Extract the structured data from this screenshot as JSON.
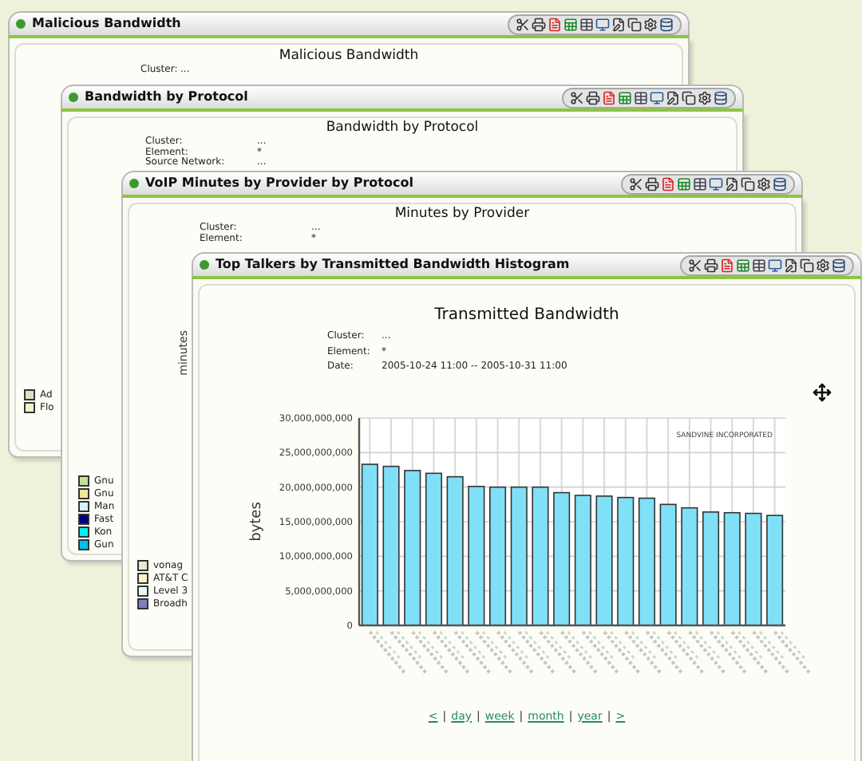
{
  "windows": [
    {
      "title": "Malicious Bandwidth",
      "report_title": "Malicious Bandwidth",
      "filters": [
        {
          "label": "Cluster:",
          "value": "..."
        }
      ],
      "legend": [
        {
          "label": "Ad",
          "color": "#d6e6c2"
        },
        {
          "label": "Flo",
          "color": "#f6f2c8"
        }
      ]
    },
    {
      "title": "Bandwidth by Protocol",
      "report_title": "Bandwidth by Protocol",
      "filters": [
        {
          "label": "Cluster:",
          "value": "..."
        },
        {
          "label": "Element:",
          "value": "*"
        },
        {
          "label": "Source Network:",
          "value": "..."
        }
      ],
      "legend": [
        {
          "label": "Gnu",
          "color": "#c6e09c"
        },
        {
          "label": "Gnu",
          "color": "#f2e89c"
        },
        {
          "label": "Man",
          "color": "#d8f4f8"
        },
        {
          "label": "Fast",
          "color": "#000080"
        },
        {
          "label": "Kon",
          "color": "#00f0f0"
        },
        {
          "label": "Gun",
          "color": "#00c0f0"
        }
      ]
    },
    {
      "title": "VoIP Minutes by Provider by Protocol",
      "report_title": "Minutes by Provider",
      "filters": [
        {
          "label": "Cluster:",
          "value": "..."
        },
        {
          "label": "Element:",
          "value": "*"
        }
      ],
      "axis_label": "minutes",
      "legend": [
        {
          "label": "vonag",
          "color": "#e0ecd0"
        },
        {
          "label": "AT&T C",
          "color": "#f8f4c8"
        },
        {
          "label": "Level 3",
          "color": "#e8f8f8"
        },
        {
          "label": "Broadh",
          "color": "#8080c0"
        }
      ]
    },
    {
      "title": "Top Talkers by Transmitted Bandwidth Histogram",
      "report_title": "Transmitted Bandwidth",
      "filters": [
        {
          "label": "Cluster:",
          "value": "..."
        },
        {
          "label": "Element:",
          "value": "*"
        },
        {
          "label": "Date:",
          "value": "2005-10-24 11:00 -- 2005-10-31 11:00"
        }
      ],
      "chart_data": {
        "type": "bar",
        "grid": true,
        "ylabel": "bytes",
        "values": [
          23300000000,
          23000000000,
          22400000000,
          22000000000,
          21500000000,
          20100000000,
          20000000000,
          20000000000,
          20000000000,
          19200000000,
          18800000000,
          18700000000,
          18500000000,
          18400000000,
          17500000000,
          17000000000,
          16400000000,
          16300000000,
          16200000000,
          15900000000
        ],
        "ylim": [
          0,
          30000000000
        ],
        "yticks": [
          {
            "value": 0,
            "label": "0"
          },
          {
            "value": 5000000000,
            "label": "5,000,000,000"
          },
          {
            "value": 10000000000,
            "label": "10,000,000,000"
          },
          {
            "value": 15000000000,
            "label": "15,000,000,000"
          },
          {
            "value": 20000000000,
            "label": "20,000,000,000"
          },
          {
            "value": 25000000000,
            "label": "25,000,000,000"
          },
          {
            "value": 30000000000,
            "label": "30,000,000,000"
          }
        ],
        "annotations": [
          "SANDVINE INCORPORATED"
        ]
      },
      "nav": {
        "separator": "|",
        "links": [
          "<",
          "day",
          "week",
          "month",
          "year",
          ">"
        ]
      }
    }
  ]
}
